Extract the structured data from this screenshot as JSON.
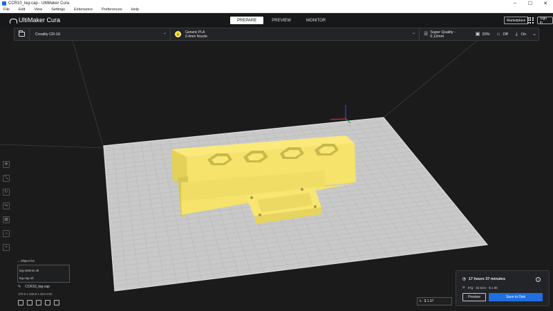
{
  "window": {
    "title": "CCR10_leg-cap - UltiMaker Cura"
  },
  "menu": [
    "File",
    "Edit",
    "View",
    "Settings",
    "Extensions",
    "Preferences",
    "Help"
  ],
  "header": {
    "logo": "UltiMaker Cura",
    "stages": [
      "PREPARE",
      "PREVIEW",
      "MONITOR"
    ],
    "active_stage": "PREPARE",
    "marketplace": "Marketplace",
    "signin": "Sign in"
  },
  "toolbar": {
    "printer": "Creality CR-10",
    "material_name": "Generic PLA",
    "nozzle": "0.4mm Nozzle",
    "profile": "Super Quality - 0.12mm",
    "infill": "20%",
    "support": "Off",
    "adhesion": "On"
  },
  "objects": {
    "header": "Object list",
    "items": [
      "leg-160mm.stl",
      "leg-cap.stl"
    ],
    "current_file": "CCR10_leg-cap",
    "dimensions": "170.0 x 100.9 x 40.0 mm"
  },
  "cost": "$ 1.97",
  "print_info": {
    "time": "17 hours 37 minutes",
    "material": "97g · 32.61m · $ 1.95",
    "preview_button": "Preview",
    "save_button": "Save to Disk"
  },
  "colors": {
    "accent": "#1f6fe0",
    "model": "#f5e36b",
    "plate": "#c9c9c9",
    "material_dot": "#ffd600"
  }
}
